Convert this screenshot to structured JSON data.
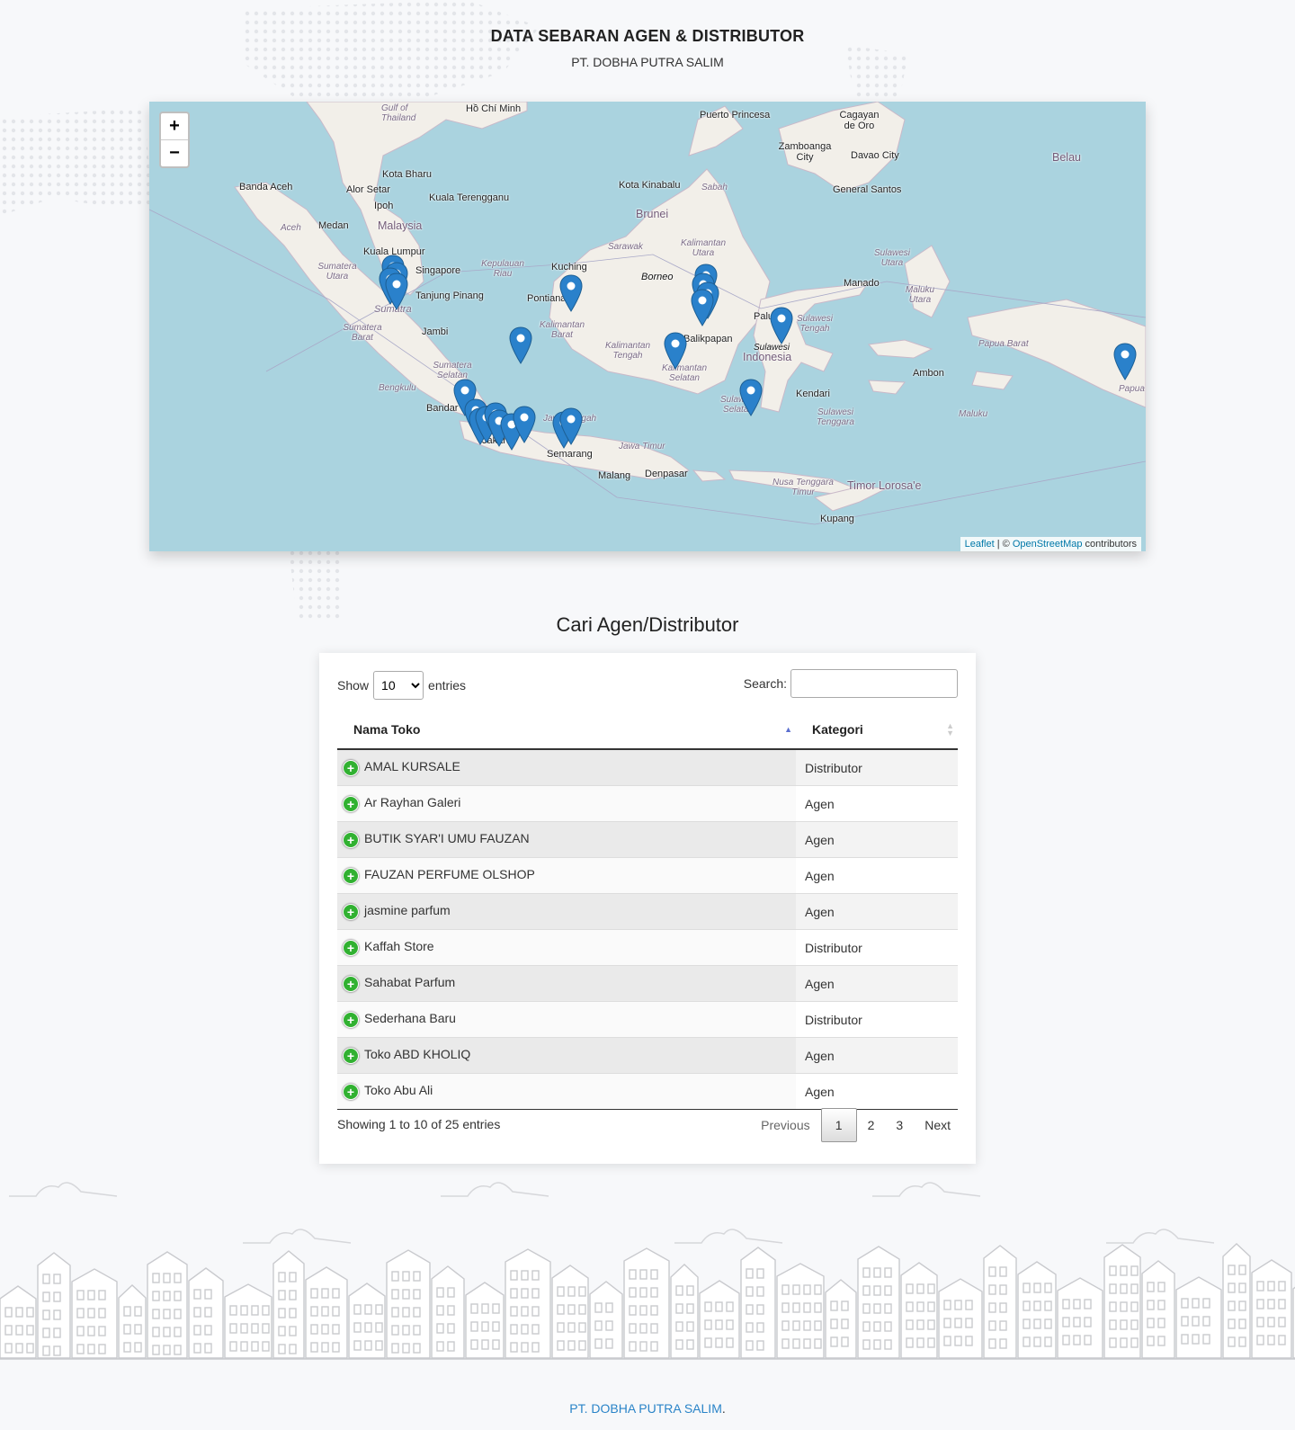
{
  "header": {
    "title": "DATA SEBARAN AGEN & DISTRIBUTOR",
    "subtitle": "PT. DOBHA PUTRA SALIM"
  },
  "map": {
    "zoom_in": "+",
    "zoom_out": "−",
    "attribution": {
      "leaflet": "Leaflet",
      "separator": " | © ",
      "osm": "OpenStreetMap",
      "suffix": " contributors"
    },
    "labels": {
      "ho_chi_minh": "Hồ Chí Minh",
      "gulf_thailand": "Gulf of Thailand",
      "puerto_princesa": "Puerto Princesa",
      "cagayan": "Cagayan de Oro",
      "zamboanga": "Zamboanga City",
      "davao": "Davao City",
      "general_santos": "General Santos",
      "belau": "Belau",
      "banda_aceh": "Banda Aceh",
      "kota_bharu": "Kota Bharu",
      "alor_setar": "Alor Setar",
      "kuala_terengganu": "Kuala Terengganu",
      "ipoh": "Ipoh",
      "malaysia": "Malaysia",
      "kota_kinabalu": "Kota Kinabalu",
      "sabah": "Sabah",
      "brunei": "Brunei",
      "aceh": "Aceh",
      "medan": "Medan",
      "kuala_lumpur": "Kuala Lumpur",
      "singapore": "Singapore",
      "tanjung_pinang": "Tanjung Pinang",
      "sumatera_utara": "Sumatera Utara",
      "kepulauan_riau": "Kepulauan Riau",
      "kuching": "Kuching",
      "sarawak": "Sarawak",
      "kalimantan_utara": "Kalimantan Utara",
      "borneo": "Borneo",
      "pontianak": "Pontianak",
      "sulawesi_utara": "Sulawesi Utara",
      "manado": "Manado",
      "maluku_utara": "Maluku Utara",
      "sumatra": "Sumatra",
      "sumatera_barat": "Sumatera Barat",
      "jambi": "Jambi",
      "kalimantan_barat": "Kalimantan Barat",
      "kalimantan_tengah": "Kalimantan Tengah",
      "balikpapan": "Balikpapan",
      "palu": "Palu",
      "sulawesi_tengah": "Sulawesi Tengah",
      "sulawesi": "Sulawesi",
      "indonesia": "Indonesia",
      "papua_barat": "Papua Barat",
      "sumatera_selatan": "Sumatera Selatan",
      "kalimantan_selatan": "Kalimantan Selatan",
      "ambon": "Ambon",
      "bengkulu": "Bengkulu",
      "kendari": "Kendari",
      "bandar_lampung": "Bandar Lampung",
      "sulawesi_selatan": "Sulawesi Selatan",
      "sulawesi_tenggara": "Sulawesi Tenggara",
      "maluku": "Maluku",
      "papua": "Papua",
      "jakarta": "Jakarta",
      "jawa_tengah": "Jawa Tengah",
      "semarang": "Semarang",
      "jawa_timur": "Jawa Timur",
      "malang": "Malang",
      "denpasar": "Denpasar",
      "ntt": "Nusa Tenggara Timur",
      "timor": "Timor Lorosa'e",
      "kupang": "Kupang"
    },
    "marker_count": 24,
    "marker_color": "#2a81cb"
  },
  "search_section": {
    "title": "Cari Agen/Distributor"
  },
  "table": {
    "show_label": "Show",
    "entries_label": "entries",
    "page_length": "10",
    "search_label": "Search:",
    "search_value": "",
    "columns": [
      "Nama Toko",
      "Kategori"
    ],
    "rows": [
      {
        "name": "AMAL KURSALE",
        "category": "Distributor"
      },
      {
        "name": "Ar Rayhan Galeri",
        "category": "Agen"
      },
      {
        "name": "BUTIK SYAR'I UMU FAUZAN",
        "category": "Agen"
      },
      {
        "name": "FAUZAN PERFUME OLSHOP",
        "category": "Agen"
      },
      {
        "name": "jasmine parfum",
        "category": "Agen"
      },
      {
        "name": "Kaffah Store",
        "category": "Distributor"
      },
      {
        "name": "Sahabat Parfum",
        "category": "Agen"
      },
      {
        "name": "Sederhana Baru",
        "category": "Distributor"
      },
      {
        "name": "Toko ABD KHOLIQ",
        "category": "Agen"
      },
      {
        "name": "Toko Abu Ali",
        "category": "Agen"
      }
    ],
    "info": "Showing 1 to 10 of 25 entries",
    "pagination": {
      "previous": "Previous",
      "pages": [
        "1",
        "2",
        "3"
      ],
      "current": "1",
      "next": "Next"
    }
  },
  "footer": {
    "company_link": "PT. DOBHA PUTRA SALIM",
    "suffix": "."
  }
}
